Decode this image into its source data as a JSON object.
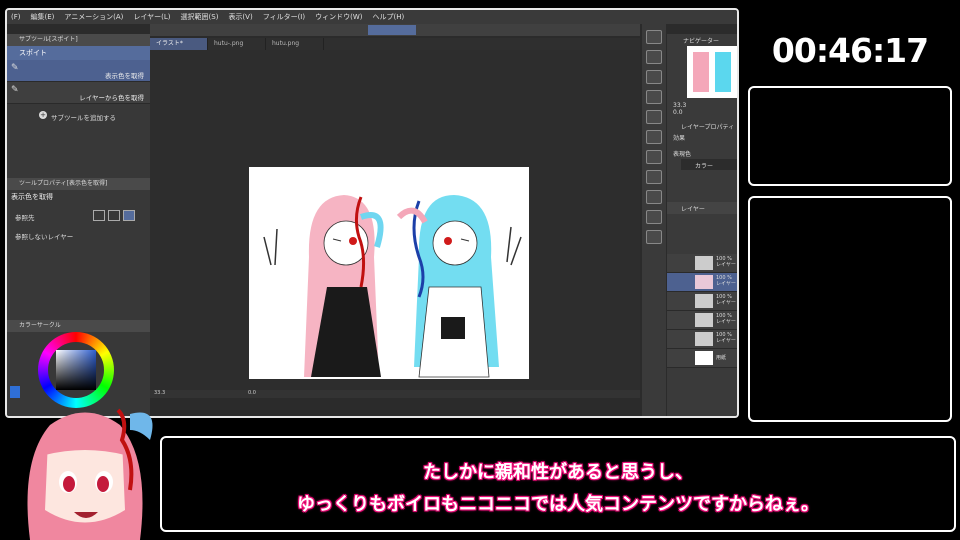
{
  "menu": [
    "(F)",
    "編集(E)",
    "アニメーション(A)",
    "レイヤー(L)",
    "選択範囲(S)",
    "表示(V)",
    "フィルター(I)",
    "ウィンドウ(W)",
    "ヘルプ(H)"
  ],
  "subtool_panel": {
    "title": "サブツール[スポイト]",
    "header": "スポイト",
    "items": [
      "表示色を取得",
      "レイヤーから色を取得"
    ],
    "add_label": "サブツールを追加する"
  },
  "tool_property": {
    "title": "ツールプロパティ[表示色を取得]",
    "name": "表示色を取得",
    "ref_label": "参照先",
    "noref_label": "参照しないレイヤー"
  },
  "color_panel_title": "カラーサークル",
  "tabs": [
    "イラスト*",
    "hutu-.png",
    "hutu.png"
  ],
  "zoom": "33.3",
  "angle": "0.0",
  "navigator_title": "ナビゲーター",
  "nav_zoom": "33.3",
  "nav_angle": "0.0",
  "layer_property": {
    "title": "レイヤープロパティ",
    "effect": "効果",
    "color_label": "表現色",
    "color_value": "カラー"
  },
  "layers_title": "レイヤー",
  "layers": [
    {
      "opacity": "100 %",
      "name": "レイヤー"
    },
    {
      "opacity": "100 %",
      "name": "レイヤー"
    },
    {
      "opacity": "100 %",
      "name": "レイヤー"
    },
    {
      "opacity": "100 %",
      "name": "レイヤー"
    },
    {
      "opacity": "100 %",
      "name": "レイヤー"
    },
    {
      "opacity": "",
      "name": "用紙"
    }
  ],
  "timer": "00:46:17",
  "subtitle": {
    "line1": "たしかに親和性があると思うし、",
    "line2": "ゆっくりもボイロもニコニコでは人気コンテンツですからねぇ。"
  },
  "colors": {
    "accent": "#556c9c",
    "subtitle_glow": "#ff1e8c",
    "panel_bg": "#383838"
  }
}
